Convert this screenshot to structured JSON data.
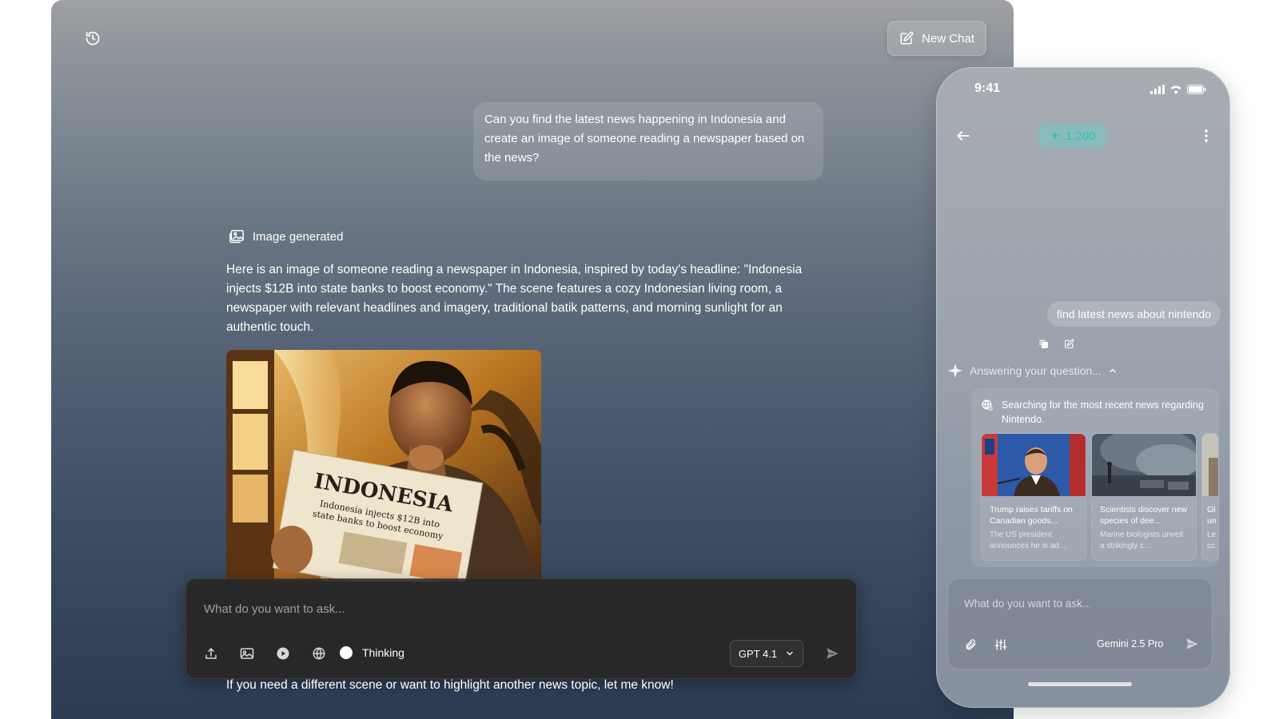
{
  "desktop": {
    "new_chat_label": "New Chat",
    "user_message": "Can you find the latest news happening in Indonesia and create an image of someone reading a newspaper based on the news?",
    "image_generated_label": "Image generated",
    "assistant_message": "Here is an image of someone reading a newspaper in Indonesia, inspired by today's headline: \"Indonesia injects $12B into state banks to boost economy.\" The scene features a cozy Indonesian living room, a newspaper with relevant headlines and imagery, traditional batik patterns, and morning sunlight for an authentic touch.",
    "image_text": {
      "headline": "INDONESIA",
      "subhead_line1": "Indonesia injects $12B into",
      "subhead_line2": "state banks to boost economy"
    },
    "composer": {
      "placeholder": "What do you want to ask...",
      "thinking_label": "Thinking",
      "model": "GPT 4.1"
    },
    "footer_message": "If you need a different scene or want to highlight another news topic, let me know!",
    "icons": [
      "history-icon",
      "edit-icon",
      "image-icon",
      "upload-icon",
      "play-icon",
      "globe-icon",
      "chevron-down-icon",
      "send-icon"
    ]
  },
  "phone": {
    "time": "9:41",
    "credits": "1,200",
    "user_message": "find latest news about nintendo",
    "answering_label": "Answering your question...",
    "search_status": "Searching for the most recent news regarding Nintendo.",
    "news": [
      {
        "title": "Trump raises tariffs on Canadian goods...",
        "desc": "The US president announces he is ad..."
      },
      {
        "title": "Scientists discover new species of dee...",
        "desc": "Marine biologists unveil a strikingly c..."
      },
      {
        "title": "Gl un",
        "desc": "Le cc"
      }
    ],
    "composer": {
      "placeholder": "What do you want to ask...",
      "model": "Gemini 2.5 Pro"
    },
    "colors": {
      "credit_accent": "#2dc7b8"
    }
  }
}
